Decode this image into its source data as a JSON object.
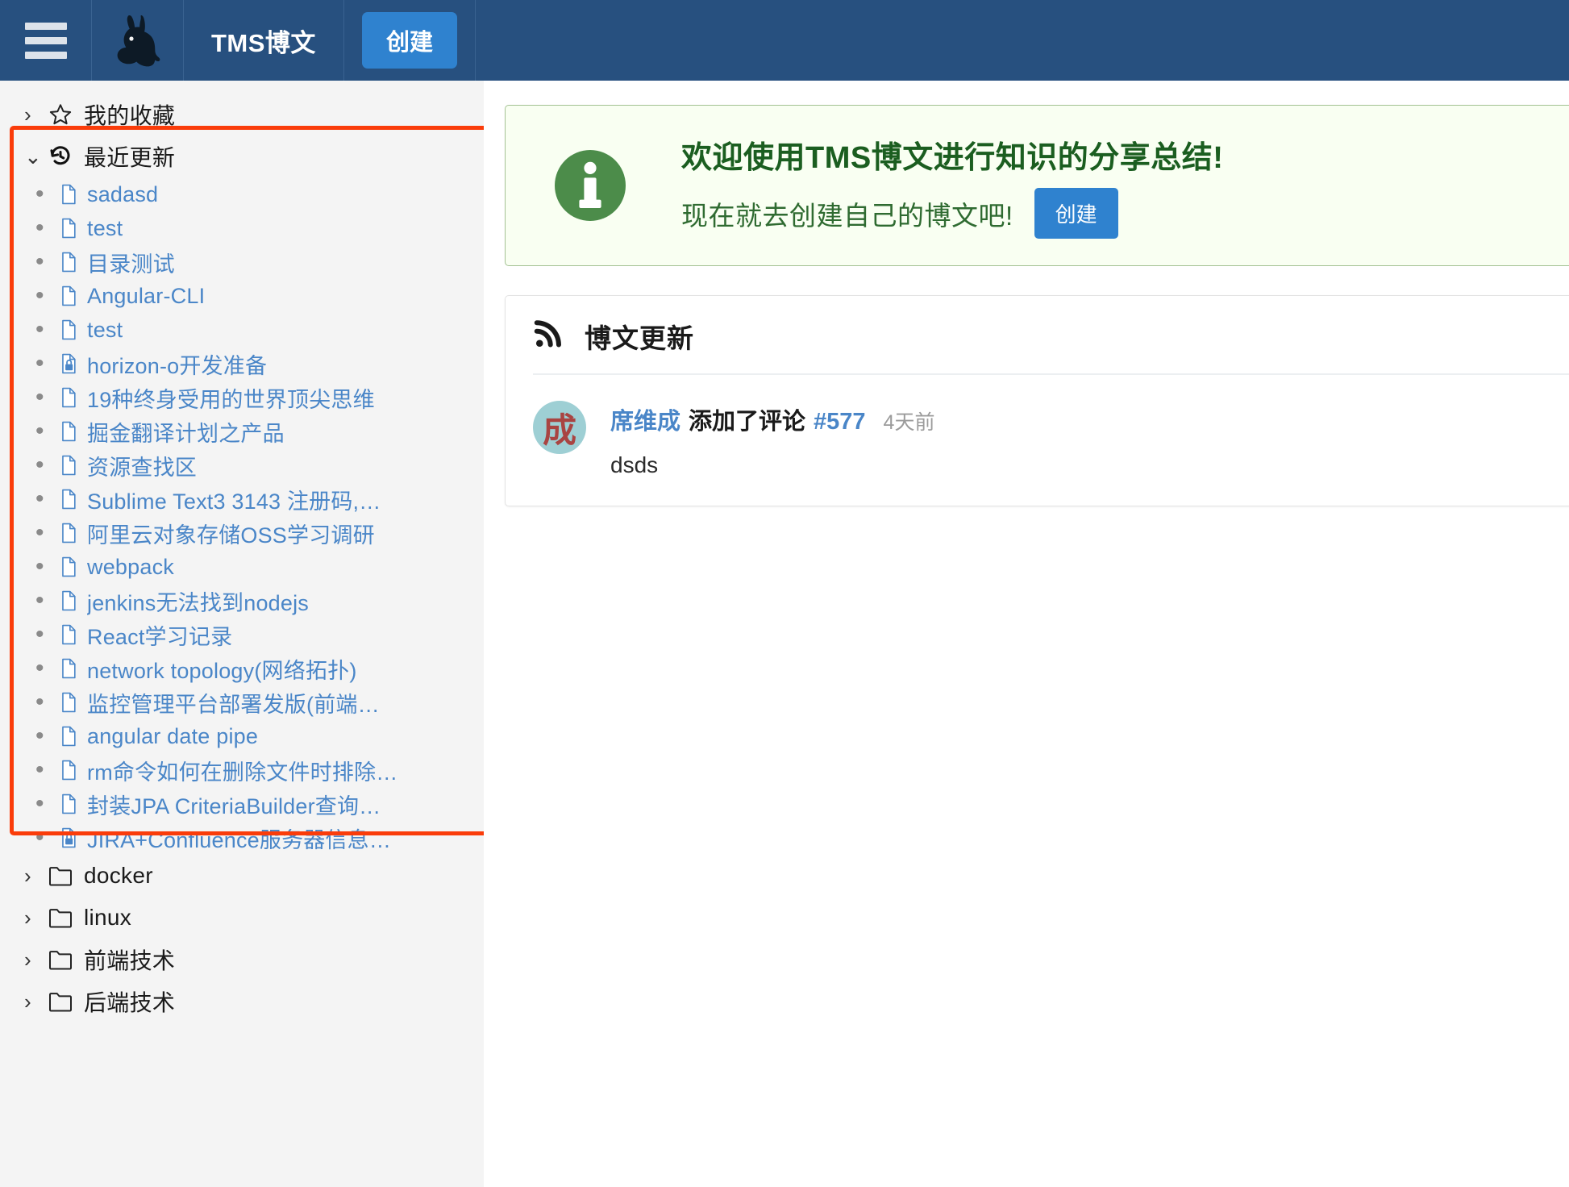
{
  "header": {
    "menu_icon": "hamburger-icon",
    "logo_icon": "rabbit-logo",
    "title": "TMS博文",
    "create_label": "创建"
  },
  "sidebar": {
    "favorites": {
      "label": "我的收藏",
      "icon": "star-icon",
      "chevron": "›",
      "expanded": false
    },
    "recent": {
      "label": "最近更新",
      "icon": "history-icon",
      "chevron": "⌄",
      "expanded": true
    },
    "recent_items": [
      {
        "label": "sadasd",
        "icon": "file-icon"
      },
      {
        "label": "test",
        "icon": "file-icon"
      },
      {
        "label": "目录测试",
        "icon": "file-icon"
      },
      {
        "label": "Angular-CLI",
        "icon": "file-icon"
      },
      {
        "label": "test",
        "icon": "file-icon"
      },
      {
        "label": "horizon-o开发准备",
        "icon": "file-lock-icon"
      },
      {
        "label": "19种终身受用的世界顶尖思维",
        "icon": "file-icon"
      },
      {
        "label": "掘金翻译计划之产品",
        "icon": "file-icon"
      },
      {
        "label": "资源查找区",
        "icon": "file-icon"
      },
      {
        "label": "Sublime Text3 3143 注册码,…",
        "icon": "file-icon"
      },
      {
        "label": "阿里云对象存储OSS学习调研",
        "icon": "file-icon"
      },
      {
        "label": "webpack",
        "icon": "file-icon"
      },
      {
        "label": "jenkins无法找到nodejs",
        "icon": "file-icon"
      },
      {
        "label": "React学习记录",
        "icon": "file-icon"
      },
      {
        "label": "network topology(网络拓扑)",
        "icon": "file-icon"
      },
      {
        "label": "监控管理平台部署发版(前端…",
        "icon": "file-icon"
      },
      {
        "label": "angular date pipe",
        "icon": "file-icon"
      },
      {
        "label": "rm命令如何在删除文件时排除…",
        "icon": "file-icon"
      },
      {
        "label": "封装JPA CriteriaBuilder查询…",
        "icon": "file-icon"
      },
      {
        "label": "JIRA+Confluence服务器信息…",
        "icon": "file-lock-icon"
      }
    ],
    "folders": [
      {
        "label": "docker",
        "icon": "folder-icon",
        "chevron": "›"
      },
      {
        "label": "linux",
        "icon": "folder-icon",
        "chevron": "›"
      },
      {
        "label": "前端技术",
        "icon": "folder-icon",
        "chevron": "›"
      },
      {
        "label": "后端技术",
        "icon": "folder-icon",
        "chevron": "›"
      }
    ],
    "highlight_color": "#FA3C0A"
  },
  "main": {
    "alert": {
      "icon": "info-circle-icon",
      "title": "欢迎使用TMS博文进行知识的分享总结!",
      "subtitle": "现在就去创建自己的博文吧!",
      "button_label": "创建",
      "bg_color": "#F9FFF2",
      "border_color": "#A3C293",
      "title_color": "#1B5E20"
    },
    "feed_card": {
      "icon": "rss-icon",
      "title": "博文更新",
      "items": [
        {
          "avatar_text": "成",
          "avatar_bg": "#9ECFD4",
          "avatar_fg": "#A94442",
          "user": "席维成",
          "action": "添加了评论",
          "reference": "#577",
          "time": "4天前",
          "content": "dsds"
        }
      ]
    }
  },
  "colors": {
    "header_bg": "#27507F",
    "accent_blue": "#2F82CF",
    "link_blue": "#4A86C8",
    "sidebar_bg": "#F4F4F4"
  }
}
